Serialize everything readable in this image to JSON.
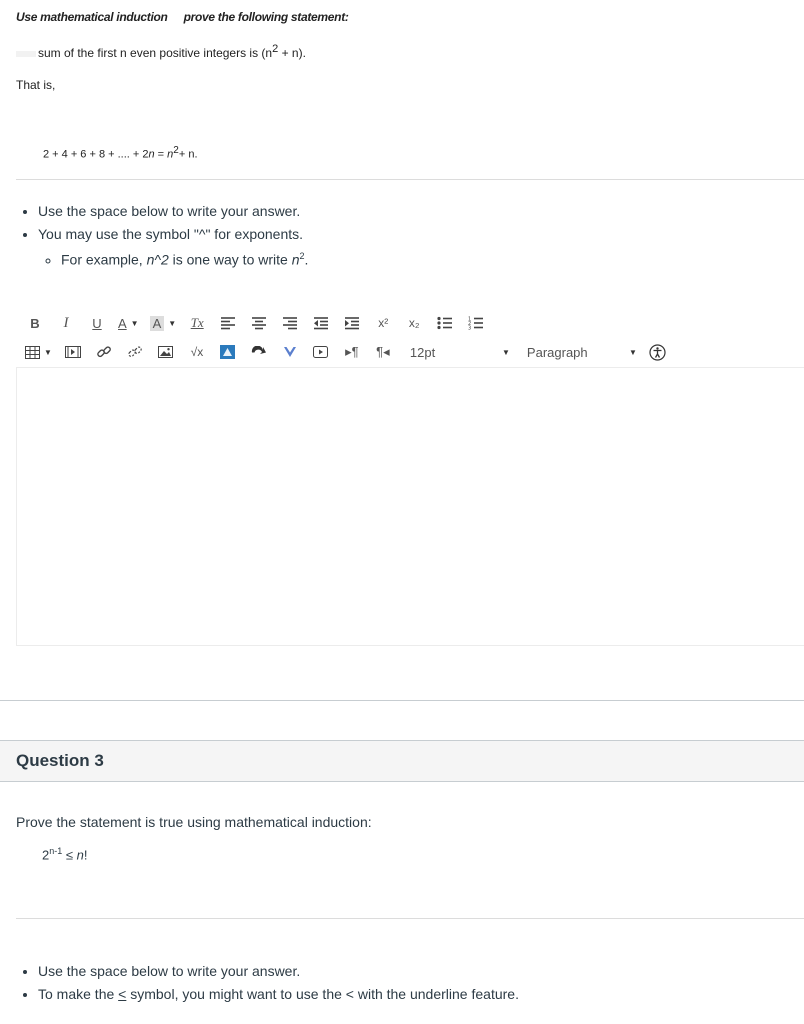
{
  "question2": {
    "intro_a": "Use mathematical induction",
    "intro_b": "prove the following statement:",
    "statement_a": "sum of the first n even positive integers is (n",
    "statement_exp": "2",
    "statement_b": " + n).",
    "that_is": "That is,",
    "eq_lhs": "2 + 4 + 6 + 8 + .... + 2",
    "eq_n": "n",
    "eq_mid": " = ",
    "eq_n2": "n",
    "eq_exp": "2",
    "eq_rhs": "+ n.",
    "bullets": {
      "b1": "Use the space below to write your answer.",
      "b2": "You may use the symbol \"^\" for exponents.",
      "sub1_a": "For example, ",
      "sub1_code": "n^2",
      "sub1_b": " is one way to write ",
      "sub1_n": "n",
      "sub1_exp": "2",
      "sub1_end": "."
    }
  },
  "toolbar": {
    "bold": "B",
    "italic": "I",
    "underline": "U",
    "font_color": "A",
    "bg_color": "A",
    "clear_format": "Tx",
    "superscript": "x²",
    "subscript": "x₂",
    "math": "√x",
    "font_size": "12pt",
    "format": "Paragraph"
  },
  "question3": {
    "title": "Question 3",
    "text": "Prove the statement is true using mathematical induction:",
    "eq_base": "2",
    "eq_exp": "n-1",
    "eq_rel": " ≤ ",
    "eq_n": "n",
    "eq_end": "!",
    "bullets": {
      "b1": "Use the space below to write your answer.",
      "b2_a": "To make the ",
      "b2_sym": "<",
      "b2_b": " symbol, you might want to use the < with the underline feature."
    }
  },
  "colors": {
    "text": "#2d3b45",
    "accent_blue": "#2b7abc",
    "band": "#f5f5f5"
  }
}
